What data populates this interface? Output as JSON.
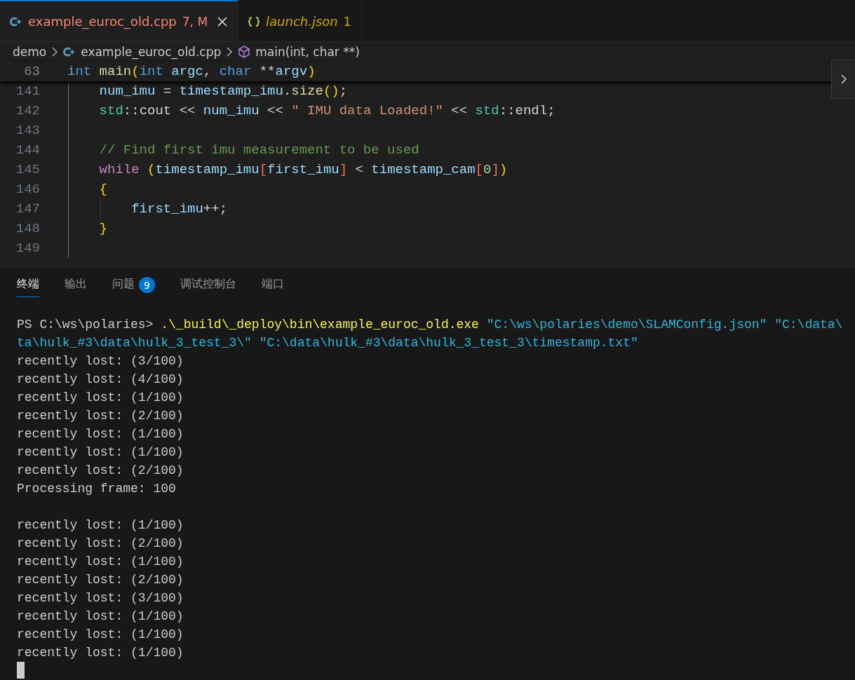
{
  "tabs": [
    {
      "label": "example_euroc_old.cpp",
      "kind": "cpp",
      "badge": "7, M",
      "has_errors": true,
      "selected": true,
      "preview": false
    },
    {
      "label": "launch.json",
      "kind": "json",
      "badge": "1",
      "has_errors": false,
      "selected": false,
      "preview": true
    }
  ],
  "breadcrumb": [
    {
      "label": "demo",
      "kind": "folder"
    },
    {
      "label": "example_euroc_old.cpp",
      "kind": "cpp"
    },
    {
      "label": "main(int, char **)",
      "kind": "symbol"
    }
  ],
  "sticky_line": {
    "number": "63",
    "tokens": [
      {
        "t": "int",
        "kind": "kw"
      },
      {
        "t": " main",
        "kind": "fn"
      },
      {
        "t": "(",
        "kind": "b1"
      },
      {
        "t": "int",
        "kind": "kw"
      },
      {
        "t": " argc",
        "kind": "var"
      },
      {
        "t": ", ",
        "kind": "plain"
      },
      {
        "t": "char",
        "kind": "kw"
      },
      {
        "t": " **",
        "kind": "plain"
      },
      {
        "t": "argv",
        "kind": "var"
      },
      {
        "t": ")",
        "kind": "b1"
      }
    ]
  },
  "code_lines": [
    {
      "number": "141",
      "guide": false,
      "tokens": [
        {
          "t": "    num_imu",
          "kind": "var"
        },
        {
          "t": " = ",
          "kind": "plain"
        },
        {
          "t": "timestamp_imu",
          "kind": "var"
        },
        {
          "t": ".",
          "kind": "plain"
        },
        {
          "t": "size",
          "kind": "fn"
        },
        {
          "t": "()",
          "kind": "b1"
        },
        {
          "t": ";",
          "kind": "plain"
        }
      ]
    },
    {
      "number": "142",
      "guide": false,
      "tokens": [
        {
          "t": "    std",
          "kind": "ns"
        },
        {
          "t": "::cout << ",
          "kind": "plain"
        },
        {
          "t": "num_imu",
          "kind": "var"
        },
        {
          "t": " << ",
          "kind": "plain"
        },
        {
          "t": "\" IMU data Loaded!\"",
          "kind": "str"
        },
        {
          "t": " << ",
          "kind": "plain"
        },
        {
          "t": "std",
          "kind": "ns"
        },
        {
          "t": "::endl;",
          "kind": "plain"
        }
      ]
    },
    {
      "number": "143",
      "guide": false
    },
    {
      "number": "144",
      "guide": false,
      "tokens": [
        {
          "t": "    // Find first imu measurement to be used",
          "kind": "comment"
        }
      ]
    },
    {
      "number": "145",
      "guide": false,
      "tokens": [
        {
          "t": "    while",
          "kind": "ctrl"
        },
        {
          "t": " (",
          "kind": "b1"
        },
        {
          "t": "timestamp_imu",
          "kind": "var"
        },
        {
          "t": "[",
          "kind": "b2"
        },
        {
          "t": "first_imu",
          "kind": "var"
        },
        {
          "t": "]",
          "kind": "b2"
        },
        {
          "t": " < ",
          "kind": "plain"
        },
        {
          "t": "timestamp_cam",
          "kind": "var"
        },
        {
          "t": "[",
          "kind": "b2"
        },
        {
          "t": "0",
          "kind": "num"
        },
        {
          "t": "]",
          "kind": "b2"
        },
        {
          "t": ")",
          "kind": "b1"
        }
      ]
    },
    {
      "number": "146",
      "guide": false,
      "tokens": [
        {
          "t": "    {",
          "kind": "b1"
        }
      ]
    },
    {
      "number": "147",
      "guide": true,
      "tokens": [
        {
          "t": "        first_imu",
          "kind": "var"
        },
        {
          "t": "++;",
          "kind": "plain"
        }
      ]
    },
    {
      "number": "148",
      "guide": false,
      "tokens": [
        {
          "t": "    }",
          "kind": "b1"
        }
      ]
    },
    {
      "number": "149",
      "guide": false
    }
  ],
  "panel_tabs": [
    {
      "label": "终端",
      "selected": true
    },
    {
      "label": "输出",
      "selected": false
    },
    {
      "label": "问题",
      "selected": false,
      "badge": "9"
    },
    {
      "label": "调试控制台",
      "selected": false
    },
    {
      "label": "端口",
      "selected": false
    }
  ],
  "terminal": [
    {
      "kind": "command",
      "tokens": [
        {
          "t": "PS C:\\ws\\polaries> ",
          "kind": "prompt"
        },
        {
          "t": ".\\_build\\_deploy\\bin\\example_euroc_old.exe",
          "kind": "exe"
        },
        {
          "t": " \"C:\\ws\\polaries\\demo\\SLAMConfig.json\" \"C:\\data\\",
          "kind": "arg"
        }
      ]
    },
    {
      "kind": "command",
      "tokens": [
        {
          "t": "ta\\hulk_#3\\data\\hulk_3_test_3\\\" \"C:\\data\\hulk_#3\\data\\hulk_3_test_3\\timestamp.txt\"",
          "kind": "arg"
        }
      ]
    },
    {
      "kind": "output",
      "text": "recently lost: (3/100)"
    },
    {
      "kind": "output",
      "text": "recently lost: (4/100)"
    },
    {
      "kind": "output",
      "text": "recently lost: (1/100)"
    },
    {
      "kind": "output",
      "text": "recently lost: (2/100)"
    },
    {
      "kind": "output",
      "text": "recently lost: (1/100)"
    },
    {
      "kind": "output",
      "text": "recently lost: (1/100)"
    },
    {
      "kind": "output",
      "text": "recently lost: (2/100)"
    },
    {
      "kind": "output",
      "text": "Processing frame: 100"
    },
    {
      "kind": "blank"
    },
    {
      "kind": "output",
      "text": "recently lost: (1/100)"
    },
    {
      "kind": "output",
      "text": "recently lost: (2/100)"
    },
    {
      "kind": "output",
      "text": "recently lost: (1/100)"
    },
    {
      "kind": "output",
      "text": "recently lost: (2/100)"
    },
    {
      "kind": "output",
      "text": "recently lost: (3/100)"
    },
    {
      "kind": "output",
      "text": "recently lost: (1/100)"
    },
    {
      "kind": "output",
      "text": "recently lost: (1/100)"
    },
    {
      "kind": "output",
      "text": "recently lost: (1/100)"
    },
    {
      "kind": "cursor"
    }
  ]
}
